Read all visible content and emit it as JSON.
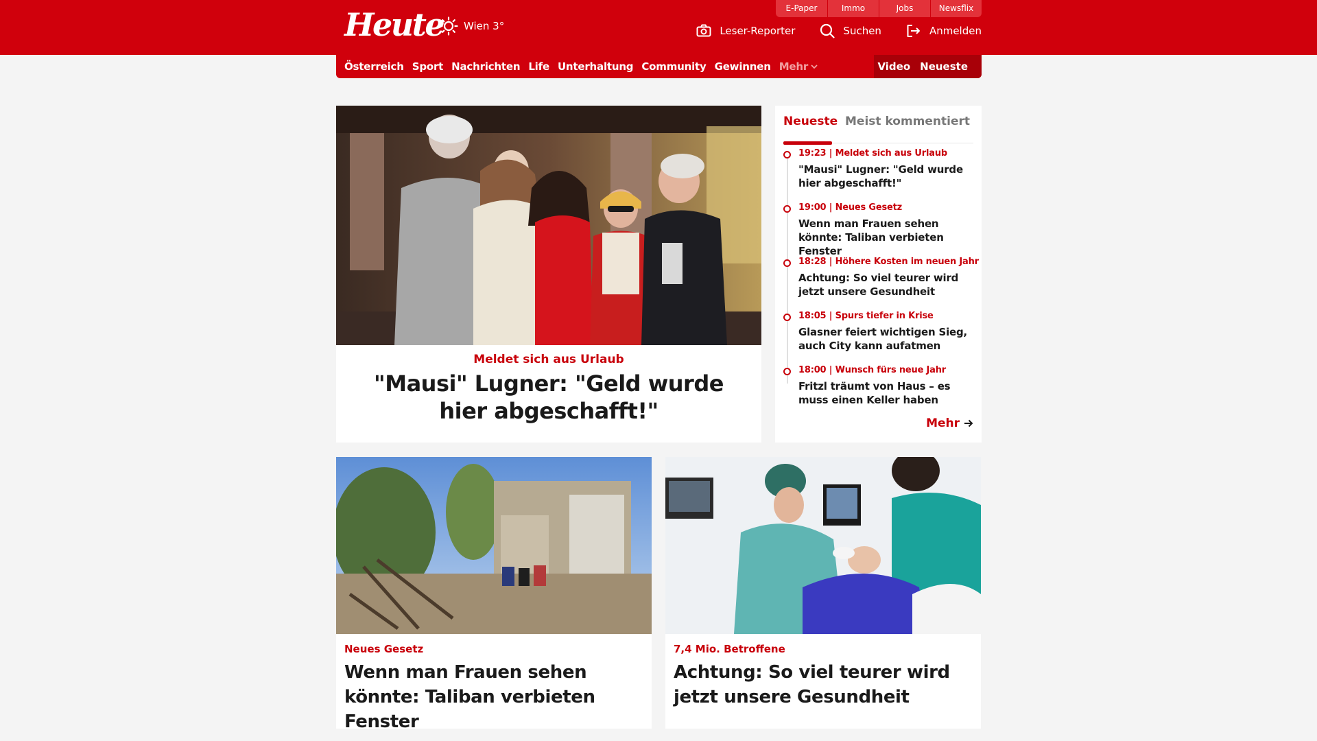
{
  "header": {
    "logo": "Heute",
    "weather": "Wien 3°",
    "quicklinks": [
      "E-Paper",
      "Immo",
      "Jobs",
      "Newsflix"
    ],
    "actions": {
      "reporter": "Leser-Reporter",
      "search": "Suchen",
      "login": "Anmelden"
    },
    "colors": {
      "brand": "#d0000c",
      "brand_dark": "#a80008",
      "accent_text": "#c8000a"
    }
  },
  "nav": {
    "items": [
      "Österreich",
      "Sport",
      "Nachrichten",
      "Life",
      "Unterhaltung",
      "Community",
      "Gewinnen"
    ],
    "more": "Mehr",
    "right": [
      "Video",
      "Neueste"
    ]
  },
  "hero": {
    "kicker": "Meldet sich aus Urlaub",
    "title": "\"Mausi\" Lugner: \"Geld wurde hier abgeschafft!\""
  },
  "sidebar": {
    "tab_active": "Neueste",
    "tab_inactive": "Meist kommentiert",
    "items": [
      {
        "meta": "19:23 | Meldet sich aus Urlaub",
        "title": "\"Mausi\" Lugner: \"Geld wurde hier abgeschafft!\""
      },
      {
        "meta": "19:00 | Neues Gesetz",
        "title": "Wenn man Frauen sehen könnte: Taliban verbieten Fenster"
      },
      {
        "meta": "18:28 | Höhere Kosten im neuen Jahr",
        "title": "Achtung: So viel teurer wird jetzt unsere Gesundheit"
      },
      {
        "meta": "18:05 | Spurs tiefer in Krise",
        "title": "Glasner feiert wichtigen Sieg, auch City kann aufatmen"
      },
      {
        "meta": "18:00 | Wunsch fürs neue Jahr",
        "title": "Fritzl träumt von Haus – es muss einen Keller haben"
      }
    ],
    "more": "Mehr"
  },
  "cards": [
    {
      "kicker": "Neues Gesetz",
      "title": "Wenn man Frauen sehen könnte: Taliban verbieten Fenster"
    },
    {
      "kicker": "7,4 Mio. Betroffene",
      "title": "Achtung: So viel teurer wird jetzt unsere Gesundheit"
    }
  ]
}
